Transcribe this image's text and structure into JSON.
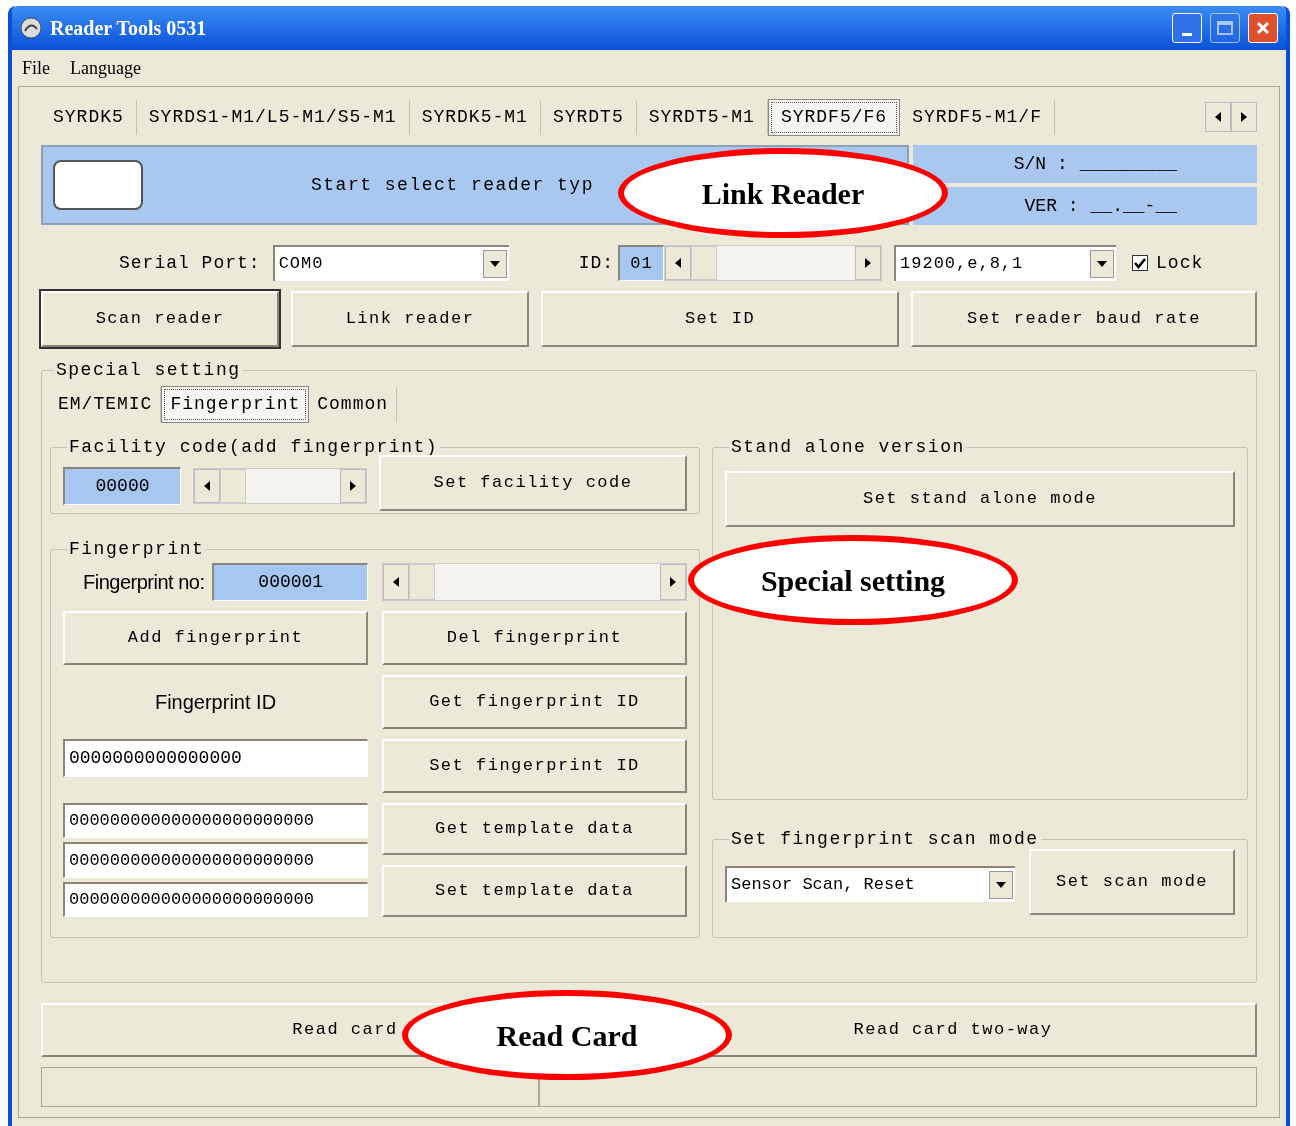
{
  "window": {
    "title": "Reader Tools 0531"
  },
  "menu": [
    "File",
    "Language"
  ],
  "reader_tabs": [
    {
      "label": "SYRDK5",
      "selected": false
    },
    {
      "label": "SYRDS1-M1/L5-M1/S5-M1",
      "selected": false
    },
    {
      "label": "SYRDK5-M1",
      "selected": false
    },
    {
      "label": "SYRDT5",
      "selected": false
    },
    {
      "label": "SYRDT5-M1",
      "selected": false
    },
    {
      "label": "SYRDF5/F6",
      "selected": true
    },
    {
      "label": "SYRDF5-M1/F",
      "selected": false
    }
  ],
  "status": {
    "message": "Start select reader typ",
    "sn_label": "S/N :",
    "sn_value": "_________",
    "ver_label": "VER :",
    "ver_value": "__.__-__"
  },
  "connection": {
    "serial_port_label": "Serial Port:",
    "serial_port": "COM0",
    "id_label": "ID:",
    "id": "01",
    "baud": "19200,e,8,1",
    "lock": {
      "label": "Lock",
      "checked": true
    }
  },
  "buttons": [
    {
      "label": "Scan reader",
      "focused": true
    },
    {
      "label": "Link reader",
      "focused": false
    },
    {
      "label": "Set ID",
      "focused": false
    },
    {
      "label": "Set reader baud rate",
      "focused": false
    }
  ],
  "special_setting": {
    "title": "Special setting",
    "tabs": [
      {
        "label": "EM/TEMIC",
        "selected": false
      },
      {
        "label": "Fingerprint",
        "selected": true
      },
      {
        "label": "Common",
        "selected": false
      }
    ],
    "facility": {
      "title": "Facility code(add fingerprint)",
      "value": "00000",
      "button": "Set facility code"
    },
    "fingerprint": {
      "title": "Fingerprint",
      "no_label": "Fingerprint no:",
      "no": "000001",
      "add_button": "Add fingerprint",
      "del_button": "Del fingerprint",
      "id_label": "Fingerprint ID",
      "id_value": "0000000000000000",
      "get_id_button": "Get fingerprint ID",
      "set_id_button": "Set fingerprint ID",
      "template_fields": [
        "000000000000000000000000",
        "000000000000000000000000",
        "000000000000000000000000"
      ],
      "get_template_button": "Get template data",
      "set_template_button": "Set template data"
    },
    "stand_alone": {
      "title": "Stand alone version",
      "button": "Set stand alone mode"
    },
    "scan_mode": {
      "title": "Set fingerprint scan mode",
      "mode": "Sensor Scan, Reset",
      "button": "Set scan mode"
    }
  },
  "read_buttons": [
    "Read card",
    "Read card two-way"
  ],
  "callouts": [
    "Link Reader",
    "Special setting",
    "Read Card"
  ]
}
